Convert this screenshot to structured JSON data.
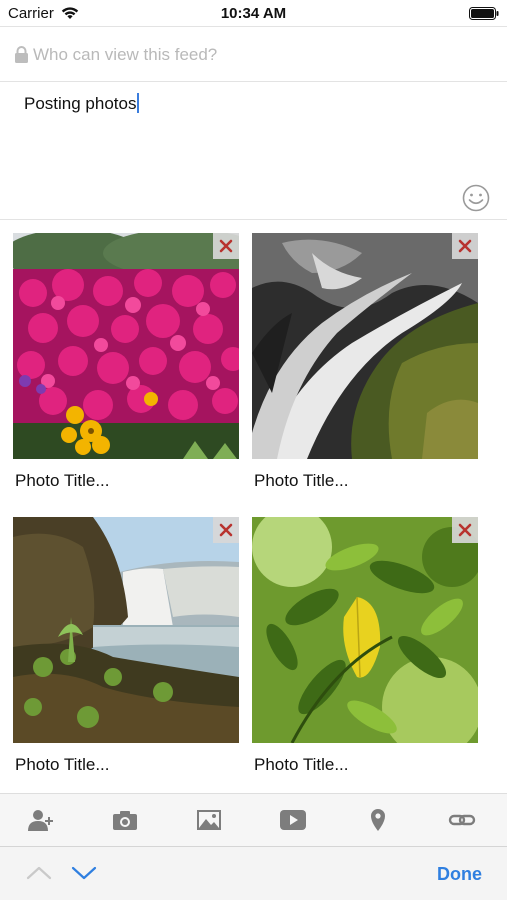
{
  "status_bar": {
    "carrier": "Carrier",
    "time": "10:34 AM"
  },
  "visibility": {
    "placeholder": "Who can view this feed?",
    "icon": "lock-icon"
  },
  "compose": {
    "text": "Posting photos",
    "emoji_icon": "smiley-icon"
  },
  "photos": [
    {
      "title": "Photo Title...",
      "subject": "pink flowers"
    },
    {
      "title": "Photo Title...",
      "subject": "waterfall rocks"
    },
    {
      "title": "Photo Title...",
      "subject": "waterfall lake"
    },
    {
      "title": "Photo Title...",
      "subject": "green leaves"
    }
  ],
  "toolbar": {
    "items": [
      "add-person-icon",
      "camera-icon",
      "image-icon",
      "video-icon",
      "location-pin-icon",
      "link-icon"
    ]
  },
  "accessory": {
    "done_label": "Done"
  },
  "colors": {
    "accent": "#2f7fe0",
    "remove": "#b8332f",
    "placeholder": "#b9b9b9"
  }
}
